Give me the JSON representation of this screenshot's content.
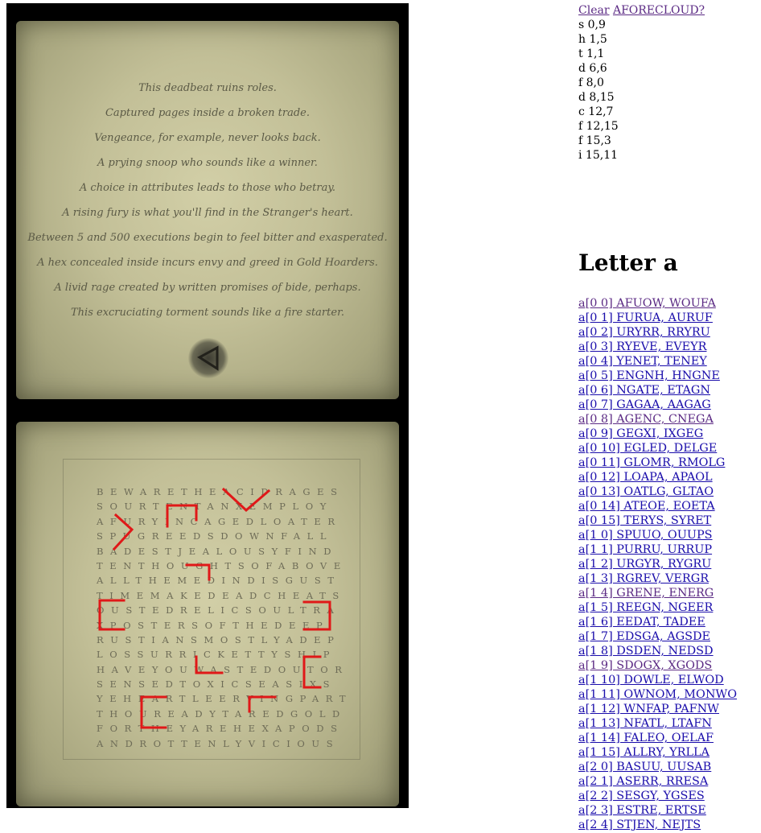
{
  "top_links": {
    "clear": "Clear",
    "forecloud": "AFORECLOUD?"
  },
  "coords": [
    "s 0,9",
    "h 1,5",
    "t 1,1",
    "d 6,6",
    "f 8,0",
    "d 8,15",
    "c 12,7",
    "f 12,15",
    "f 15,3",
    "i 15,11"
  ],
  "heading": "Letter a",
  "poem": [
    "This deadbeat ruins roles.",
    "Captured pages inside a broken trade.",
    "Vengeance, for example, never looks back.",
    "A prying snoop who sounds like a winner.",
    "A choice in attributes leads to those who betray.",
    "A rising fury is what you'll find in the Stranger's heart.",
    "Between 5 and 500 executions begin to feel bitter and exasperated.",
    "A hex concealed inside incurs envy and greed in Gold Hoarders.",
    "A livid rage created by written promises of bide, perhaps.",
    "This excruciating torment sounds like a fire starter."
  ],
  "grid": [
    "BEWARETHEACIDRAGES",
    "SOURTENTANXEMPLOY",
    "AFURYINCAGEDLOATER",
    "SPUGREEDSDOWNFALL",
    "BADESTJEALOUSYFIND",
    "TENTHOUGHTSOFABOVE",
    "ALLTHEMEDINDISGUST",
    "TIMEMAKEDEADCHEATS",
    "OUSTEDRELICSOULTRA",
    "XPOSTERSOFTHEDEEP",
    "RUSTIANSMOSTLYADEP",
    "LOSSURRICKETTYSHIP",
    "HAVEYOUWASTEDOUTOR",
    "SENSEDTOXICSEASIXS",
    "YEHEARTLEERVINGPART",
    "THOUREADYTAREDGOLD",
    "FORTHEYAREHEXAPODS",
    "ANDROTTENLYVICIOUS"
  ],
  "links": [
    {
      "label": "a[0 0] AFUOW, WOUFA",
      "visited": true
    },
    {
      "label": "a[0 1] FURUA, AURUF",
      "visited": false
    },
    {
      "label": "a[0 2] URYRR, RRYRU",
      "visited": false
    },
    {
      "label": "a[0 3] RYEVE, EVEYR",
      "visited": false
    },
    {
      "label": "a[0 4] YENET, TENEY",
      "visited": false
    },
    {
      "label": "a[0 5] ENGNH, HNGNE",
      "visited": false
    },
    {
      "label": "a[0 6] NGATE, ETAGN",
      "visited": false
    },
    {
      "label": "a[0 7] GAGAA, AAGAG",
      "visited": false
    },
    {
      "label": "a[0 8] AGENC, CNEGA",
      "visited": true
    },
    {
      "label": "a[0 9] GEGXI, IXGEG",
      "visited": false
    },
    {
      "label": "a[0 10] EGLED, DELGE",
      "visited": false
    },
    {
      "label": "a[0 11] GLOMR, RMOLG",
      "visited": false
    },
    {
      "label": "a[0 12] LOAPA, APAOL",
      "visited": false
    },
    {
      "label": "a[0 13] OATLG, GLTAO",
      "visited": false
    },
    {
      "label": "a[0 14] ATEOE, EOETA",
      "visited": false
    },
    {
      "label": "a[0 15] TERYS, SYRET",
      "visited": false
    },
    {
      "label": "a[1 0] SPUUO, OUUPS",
      "visited": false
    },
    {
      "label": "a[1 1] PURRU, URRUP",
      "visited": false
    },
    {
      "label": "a[1 2] URGYR, RYGRU",
      "visited": false
    },
    {
      "label": "a[1 3] RGREV, VERGR",
      "visited": false
    },
    {
      "label": "a[1 4] GRENE, ENERG",
      "visited": true
    },
    {
      "label": "a[1 5] REEGN, NGEER",
      "visited": false
    },
    {
      "label": "a[1 6] EEDAT, TADEE",
      "visited": false
    },
    {
      "label": "a[1 7] EDSGA, AGSDE",
      "visited": false
    },
    {
      "label": "a[1 8] DSDEN, NEDSD",
      "visited": false
    },
    {
      "label": "a[1 9] SDOGX, XGODS",
      "visited": true
    },
    {
      "label": "a[1 10] DOWLE, ELWOD",
      "visited": false
    },
    {
      "label": "a[1 11] OWNOM, MONWO",
      "visited": false
    },
    {
      "label": "a[1 12] WNFAP, PAFNW",
      "visited": false
    },
    {
      "label": "a[1 13] NFATL, LTAFN",
      "visited": false
    },
    {
      "label": "a[1 14] FALEO, OELAF",
      "visited": false
    },
    {
      "label": "a[1 15] ALLRY, YRLLA",
      "visited": false
    },
    {
      "label": "a[2 0] BASUU, UUSAB",
      "visited": false
    },
    {
      "label": "a[2 1] ASERR, RRESA",
      "visited": false
    },
    {
      "label": "a[2 2] SESGY, YGSES",
      "visited": false
    },
    {
      "label": "a[2 3] ESTRE, ERTSE",
      "visited": false
    },
    {
      "label": "a[2 4] STJEN, NEJTS",
      "visited": false
    }
  ]
}
